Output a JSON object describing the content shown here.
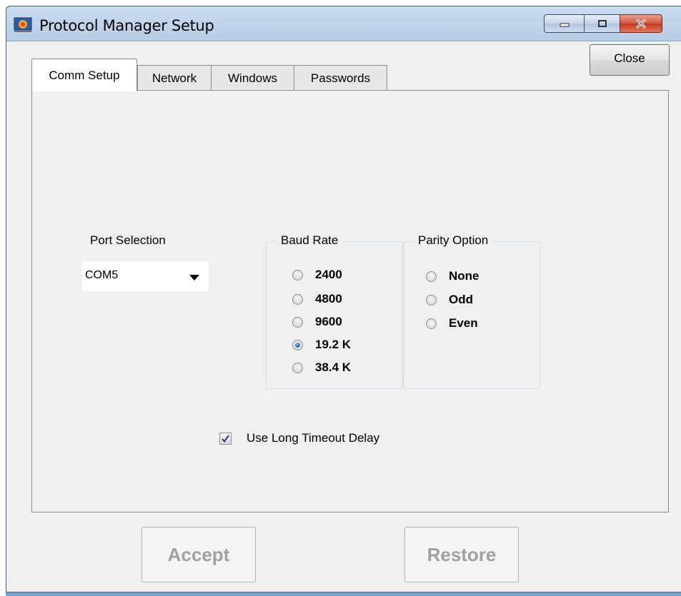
{
  "window": {
    "title": "Protocol Manager Setup",
    "controls": {
      "minimize_icon": "minimize-icon",
      "maximize_icon": "maximize-icon",
      "close_icon": "close-x-icon"
    },
    "close_accent": "#c2391b"
  },
  "close_button": {
    "label": "Close"
  },
  "tabs": [
    {
      "label": "Comm Setup",
      "active": true
    },
    {
      "label": "Network",
      "active": false
    },
    {
      "label": "Windows",
      "active": false
    },
    {
      "label": "Passwords",
      "active": false
    }
  ],
  "port": {
    "label": "Port Selection",
    "selected": "COM5"
  },
  "baud": {
    "title": "Baud Rate",
    "options": [
      {
        "label": "2400",
        "checked": false
      },
      {
        "label": "4800",
        "checked": false
      },
      {
        "label": "9600",
        "checked": false
      },
      {
        "label": "19.2 K",
        "checked": true
      },
      {
        "label": "38.4 K",
        "checked": false
      }
    ]
  },
  "parity": {
    "title": "Parity Option",
    "options": [
      {
        "label": "None",
        "checked": false
      },
      {
        "label": "Odd",
        "checked": false
      },
      {
        "label": "Even",
        "checked": false
      }
    ]
  },
  "timeout": {
    "label": "Use Long Timeout Delay",
    "checked": true
  },
  "buttons": {
    "accept": "Accept",
    "restore": "Restore"
  }
}
